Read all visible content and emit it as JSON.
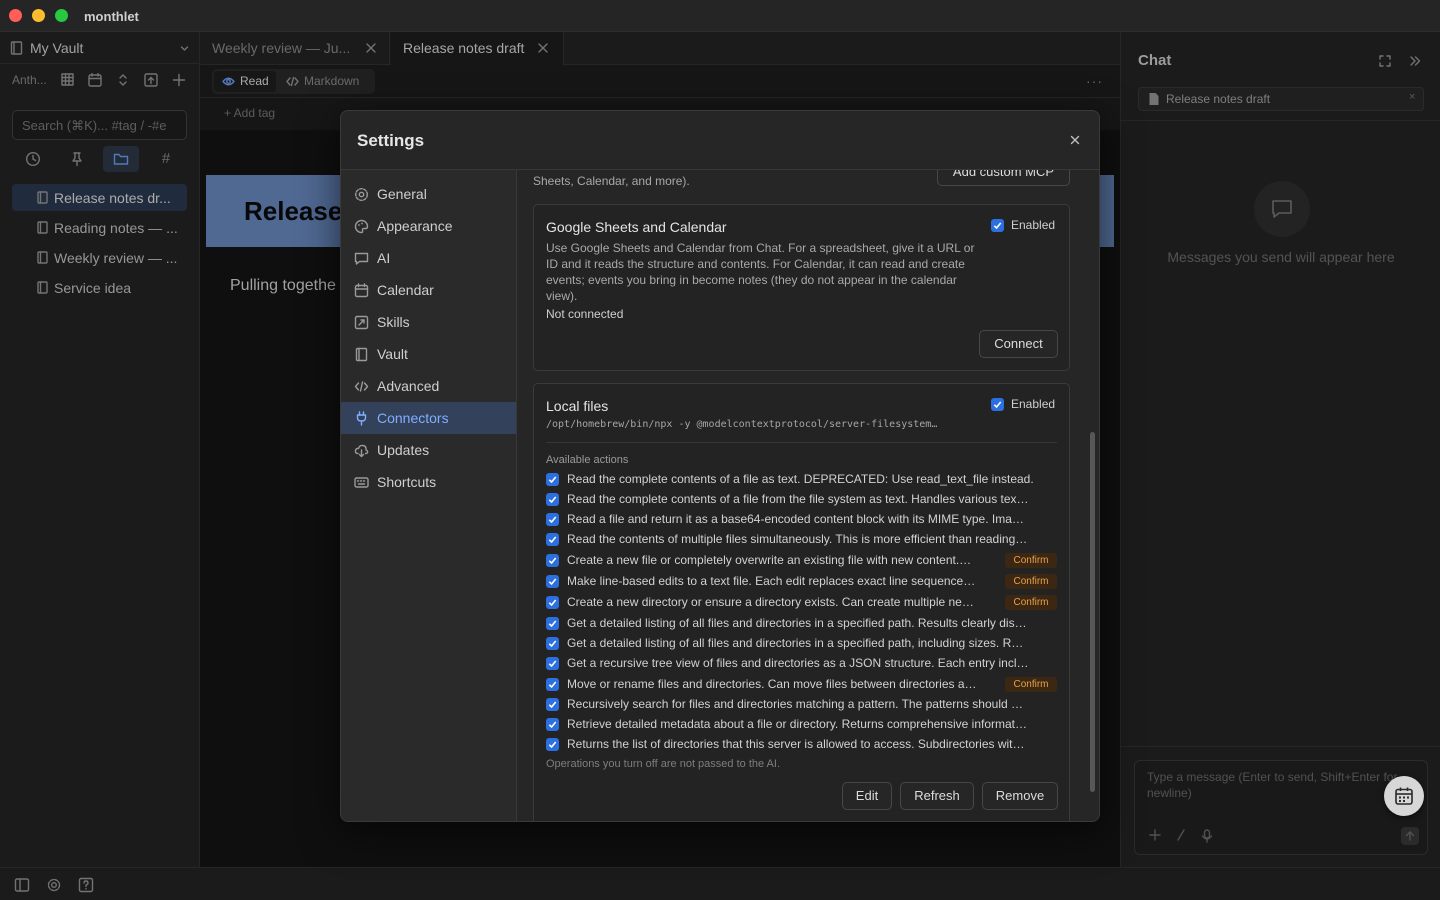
{
  "app": {
    "title": "monthlet"
  },
  "sidebar": {
    "vault_name": "My Vault",
    "toolbar_label": "Anth...",
    "search_placeholder": "Search (⌘K)... #tag / -#e",
    "files": [
      {
        "label": "Release notes dr...",
        "active": true
      },
      {
        "label": "Reading notes — ...",
        "active": false
      },
      {
        "label": "Weekly review — ...",
        "active": false
      },
      {
        "label": "Service idea",
        "active": false
      }
    ]
  },
  "editor": {
    "tabs": [
      {
        "label": "Weekly review — Ju...",
        "active": false
      },
      {
        "label": "Release notes draft",
        "active": true
      }
    ],
    "modes": {
      "read": "Read",
      "markdown": "Markdown"
    },
    "more": "···",
    "add_tag": "+ Add tag",
    "doc_title": "Release",
    "doc_body": "Pulling togethe",
    "banner_color": "#6b8cc4"
  },
  "chat": {
    "title": "Chat",
    "context_file": "Release notes draft",
    "context_remove": "×",
    "empty_message": "Messages you send will appear here",
    "composer_placeholder": "Type a message (Enter to send, Shift+Enter for newline)"
  },
  "settings": {
    "title": "Settings",
    "close": "×",
    "nav": [
      {
        "label": "General",
        "icon": "gear-icon"
      },
      {
        "label": "Appearance",
        "icon": "palette-icon"
      },
      {
        "label": "AI",
        "icon": "message-icon"
      },
      {
        "label": "Calendar",
        "icon": "calendar-icon"
      },
      {
        "label": "Skills",
        "icon": "skills-icon"
      },
      {
        "label": "Vault",
        "icon": "book-icon"
      },
      {
        "label": "Advanced",
        "icon": "code-icon"
      },
      {
        "label": "Connectors",
        "icon": "plug-icon",
        "active": true
      },
      {
        "label": "Updates",
        "icon": "cloud-download-icon"
      },
      {
        "label": "Shortcuts",
        "icon": "keyboard-icon"
      }
    ],
    "connectors": {
      "lead_text": "Sheets, Calendar, and more).",
      "add_custom_mcp": "Add custom MCP",
      "google": {
        "title": "Google Sheets and Calendar",
        "enabled_label": "Enabled",
        "description": "Use Google Sheets and Calendar from Chat. For a spreadsheet, give it a URL or ID and it reads the structure and contents. For Calendar, it can read and create events; events you bring in become notes (they do not appear in the calendar view).",
        "status": "Not connected",
        "connect": "Connect"
      },
      "local": {
        "title": "Local files",
        "enabled_label": "Enabled",
        "command": "/opt/homebrew/bin/npx -y @modelcontextprotocol/server-filesystem…",
        "actions_label": "Available actions",
        "confirm_label": "Confirm",
        "actions": [
          {
            "text": "Read the complete contents of a file as text. DEPRECATED: Use read_text_file instead.",
            "confirm": false
          },
          {
            "text": "Read the complete contents of a file from the file system as text. Handles various tex…",
            "confirm": false
          },
          {
            "text": "Read a file and return it as a base64-encoded content block with its MIME type. Ima…",
            "confirm": false
          },
          {
            "text": "Read the contents of multiple files simultaneously. This is more efficient than reading…",
            "confirm": false
          },
          {
            "text": "Create a new file or completely overwrite an existing file with new content.…",
            "confirm": true
          },
          {
            "text": "Make line-based edits to a text file. Each edit replaces exact line sequence…",
            "confirm": true
          },
          {
            "text": "Create a new directory or ensure a directory exists. Can create multiple ne…",
            "confirm": true
          },
          {
            "text": "Get a detailed listing of all files and directories in a specified path. Results clearly dis…",
            "confirm": false
          },
          {
            "text": "Get a detailed listing of all files and directories in a specified path, including sizes. R…",
            "confirm": false
          },
          {
            "text": "Get a recursive tree view of files and directories as a JSON structure. Each entry incl…",
            "confirm": false
          },
          {
            "text": "Move or rename files and directories. Can move files between directories a…",
            "confirm": true
          },
          {
            "text": "Recursively search for files and directories matching a pattern. The patterns should …",
            "confirm": false
          },
          {
            "text": "Retrieve detailed metadata about a file or directory. Returns comprehensive informat…",
            "confirm": false
          },
          {
            "text": "Returns the list of directories that this server is allowed to access. Subdirectories wit…",
            "confirm": false
          }
        ],
        "ops_note": "Operations you turn off are not passed to the AI.",
        "edit": "Edit",
        "refresh": "Refresh",
        "remove": "Remove"
      }
    }
  }
}
